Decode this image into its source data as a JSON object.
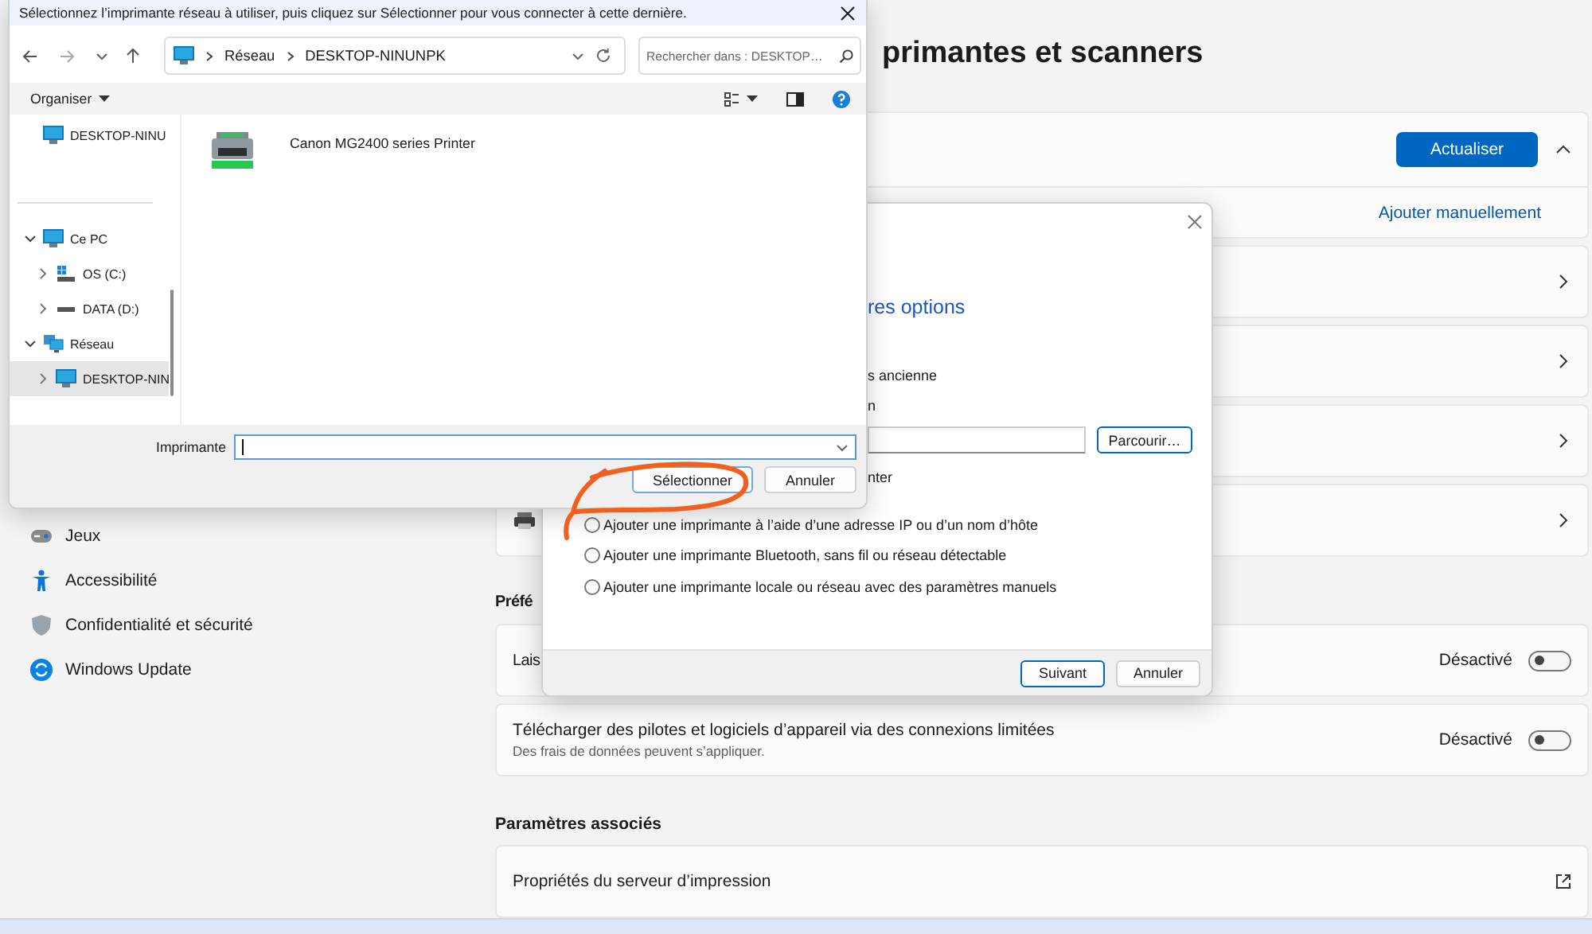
{
  "settings": {
    "title": "primantes et scanners",
    "sidebar": [
      {
        "label": "Jeux",
        "kind": "games"
      },
      {
        "label": "Accessibilité",
        "kind": "accessibility"
      },
      {
        "label": "Confidentialité et sécurité",
        "kind": "shield"
      },
      {
        "label": "Windows Update",
        "kind": "update"
      }
    ],
    "refresh_button": "Actualiser",
    "add_manually": "Ajouter manuellement",
    "device_rows": [
      {
        "kind": "blank"
      },
      {
        "kind": "blank"
      },
      {
        "kind": "blank"
      },
      {
        "kind": "printer"
      }
    ],
    "preferences_heading": "Préfé",
    "toggles": [
      {
        "label": "Lais",
        "state": "Désactivé",
        "on": false
      },
      {
        "label": "Télécharger des pilotes et logiciels d’appareil via des connexions limitées",
        "sublabel": "Des frais de données peuvent s’appliquer.",
        "state": "Désactivé",
        "on": false
      }
    ],
    "related_heading": "Paramètres associés",
    "related": [
      {
        "label": "Propriétés du serveur d’impression"
      }
    ]
  },
  "add_printer_dialog": {
    "heading": "res options",
    "lines": [
      {
        "kind": "text",
        "text": "s ancienne"
      },
      {
        "kind": "text",
        "text": "n"
      },
      {
        "kind": "path",
        "button": "Parcourir…"
      },
      {
        "kind": "text",
        "text": "nter"
      }
    ],
    "options": [
      {
        "label": "Ajouter une imprimante à l’aide d’une adresse IP ou d’un nom d’hôte",
        "selected": false
      },
      {
        "label": "Ajouter une imprimante Bluetooth, sans fil ou réseau détectable",
        "selected": false
      },
      {
        "label": "Ajouter une imprimante locale ou réseau avec des paramètres manuels",
        "selected": false
      }
    ],
    "buttons": [
      {
        "label": "Suivant",
        "kind": "primary"
      },
      {
        "label": "Annuler",
        "kind": "normal"
      }
    ]
  },
  "file_dialog": {
    "title": "Sélectionnez l’imprimante réseau à utiliser, puis cliquez sur Sélectionner pour vous connecter à cette dernière.",
    "address": [
      "Réseau",
      "DESKTOP-NINUNPK"
    ],
    "search_placeholder": "Rechercher dans : DESKTOP…",
    "organize": "Organiser",
    "quick": [
      {
        "label": "DESKTOP-NINU",
        "kind": "pc",
        "selected": false
      }
    ],
    "tree": [
      {
        "label": "Ce PC",
        "kind": "pc",
        "expanded": true,
        "selected": false,
        "children": [
          {
            "label": "OS (C:)",
            "kind": "os",
            "expanded": false,
            "selected": false
          },
          {
            "label": "DATA (D:)",
            "kind": "drive",
            "expanded": false,
            "selected": false
          }
        ]
      },
      {
        "label": "Réseau",
        "kind": "network",
        "expanded": true,
        "selected": false,
        "children": [
          {
            "label": "DESKTOP-NIN",
            "kind": "pc",
            "expanded": false,
            "selected": true
          }
        ]
      }
    ],
    "items": [
      {
        "label": "Canon MG2400 series Printer"
      }
    ],
    "field_label": "Imprimante",
    "buttons": [
      {
        "label": "Sélectionner",
        "kind": "primary"
      },
      {
        "label": "Annuler",
        "kind": "normal"
      }
    ]
  }
}
